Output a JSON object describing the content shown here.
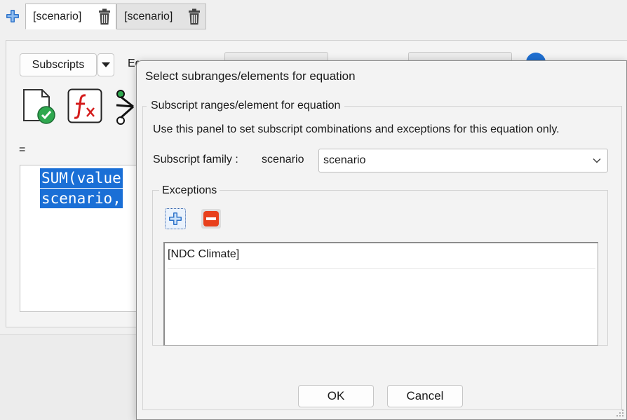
{
  "editor": {
    "tabs": [
      {
        "label": "[scenario]"
      },
      {
        "label": "[scenario]"
      }
    ],
    "subscripts_button": "Subscripts",
    "equation_type_label_partial": "Eq",
    "equals_sign": "=",
    "equation_lines": [
      "SUM(value",
      "scenario,"
    ]
  },
  "dialog": {
    "title": "Select subranges/elements for equation",
    "group_legend": "Subscript ranges/element for equation",
    "help_text": "Use this panel to set subscript combinations and exceptions for this equation only.",
    "subscript_family_label": "Subscript family :",
    "subscript_family_value": "scenario",
    "subscript_family_select": "scenario",
    "exceptions_legend": "Exceptions",
    "exceptions": [
      "[NDC Climate]"
    ],
    "ok_label": "OK",
    "cancel_label": "Cancel"
  },
  "colors": {
    "selection": "#1a6fd6",
    "remove_red": "#e8401c",
    "add_blue": "#2f73c9",
    "check_green": "#2fa84f",
    "fx_red": "#d41c1c"
  }
}
